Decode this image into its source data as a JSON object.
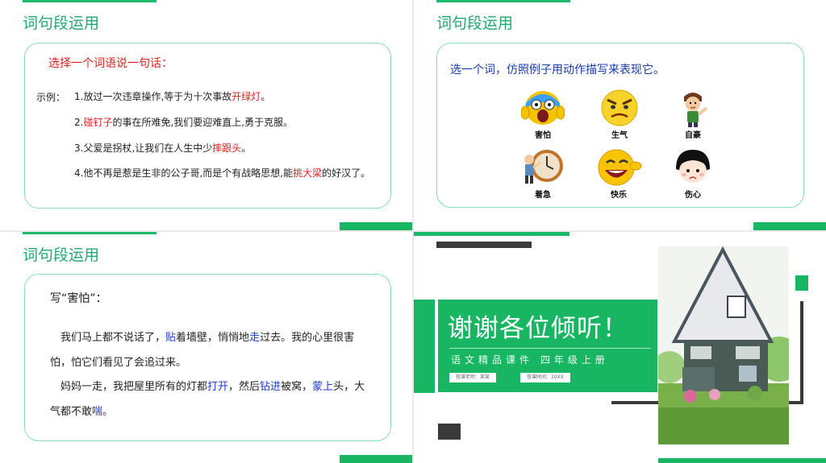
{
  "slide1": {
    "title": "词句段运用",
    "prompt": "选择一个词语说一句话：",
    "example_label": "示例：",
    "examples": [
      {
        "pre": "1.放过一次违章操作,等于为十次事故",
        "hl": "开绿灯",
        "post": "。"
      },
      {
        "pre": "2.",
        "hl": "碰钉子",
        "post": "的事在所难免,我们要迎难直上,勇于克服。"
      },
      {
        "pre": "3.父爱是拐杖,让我们在人生中少",
        "hl": "摔跟头",
        "post": "。"
      },
      {
        "pre": "4.他不再是惹是生非的公子哥,而是个有战略思想,能",
        "hl": "挑大梁",
        "post": "的好汉了。"
      }
    ]
  },
  "slide2": {
    "title": "词句段运用",
    "prompt": "选一个词，仿照例子用动作描写来表现它。",
    "emotions": [
      {
        "label": "害怕",
        "icon": "scared-face-icon"
      },
      {
        "label": "生气",
        "icon": "angry-face-icon"
      },
      {
        "label": "自豪",
        "icon": "proud-boy-icon"
      },
      {
        "label": "着急",
        "icon": "anxious-clock-man-icon"
      },
      {
        "label": "快乐",
        "icon": "happy-face-icon"
      },
      {
        "label": "伤心",
        "icon": "sad-girl-icon"
      }
    ]
  },
  "slide3": {
    "title": "词句段运用",
    "heading": "写“害怕”：",
    "p1": [
      {
        "t": "我们马上都不说话了，",
        "hl": false
      },
      {
        "t": "贴",
        "hl": true
      },
      {
        "t": "着墙壁，悄悄地",
        "hl": false
      },
      {
        "t": "走",
        "hl": true
      },
      {
        "t": "过去。我的心里很害怕，怕它们看见了会追过来。",
        "hl": false
      }
    ],
    "p2": [
      {
        "t": "妈妈一走，我把屋里所有的灯都",
        "hl": false
      },
      {
        "t": "打开",
        "hl": true
      },
      {
        "t": "，然后",
        "hl": false
      },
      {
        "t": "钻进",
        "hl": true
      },
      {
        "t": "被窝，",
        "hl": false
      },
      {
        "t": "蒙上",
        "hl": true
      },
      {
        "t": "头，大气都不敢",
        "hl": false
      },
      {
        "t": "喘",
        "hl": true
      },
      {
        "t": "。",
        "hl": false
      }
    ]
  },
  "slide4": {
    "thanks": "谢谢各位倾听！",
    "subtitle": "语文精品课件  四年级上册",
    "teacher": "授课老师：某某",
    "time": "授课时间：20XX"
  },
  "colors": {
    "accent": "#18b562",
    "title_green": "#20a870",
    "highlight_red": "#e02020",
    "highlight_blue": "#1a3ad0"
  }
}
